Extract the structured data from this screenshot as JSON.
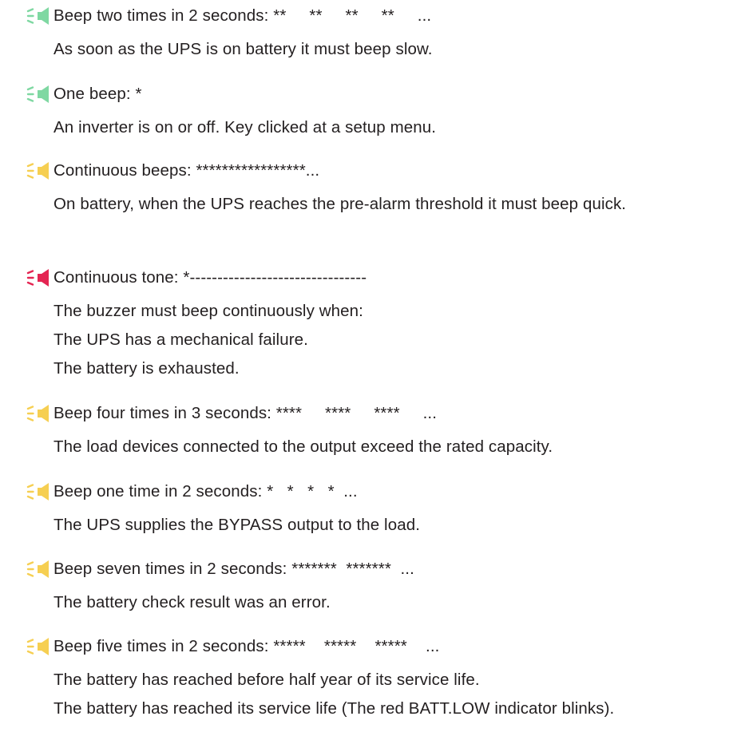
{
  "colors": {
    "green": "#7fd8a2",
    "yellow": "#f6cf52",
    "red": "#e42552",
    "text": "#231f20"
  },
  "icon_name": "speaker-beep-icon",
  "entries": [
    {
      "color": "green",
      "title": "Beep two times in 2 seconds: **     **     **     **     ...",
      "lines": [
        "As soon as the UPS is on battery it must beep slow."
      ]
    },
    {
      "color": "green",
      "title": "One beep: *",
      "lines": [
        "An inverter is on or off. Key clicked at a setup menu."
      ]
    },
    {
      "color": "yellow",
      "title": "Continuous beeps: *****************...",
      "lines": [
        "On battery, when the UPS reaches the pre-alarm threshold it must beep quick."
      ]
    },
    {
      "color": "red",
      "title": "Continuous tone: *--------------------------------",
      "lines": [
        "The buzzer must beep continuously when:",
        "The UPS has a mechanical failure.",
        "The battery is exhausted."
      ]
    },
    {
      "color": "yellow",
      "title": "Beep four times in 3 seconds: ****     ****     ****     ...",
      "lines": [
        "The load devices connected to the output exceed the rated capacity."
      ]
    },
    {
      "color": "yellow",
      "title": "Beep one time in 2 seconds: *   *   *   *  ...",
      "lines": [
        "The UPS supplies the BYPASS output to the load."
      ]
    },
    {
      "color": "yellow",
      "title": "Beep seven times in 2 seconds: *******  *******  ...",
      "lines": [
        "The battery check result was an error."
      ]
    },
    {
      "color": "yellow",
      "title": "Beep five times in 2 seconds: *****    *****    *****    ...",
      "lines": [
        "The battery has reached before half year of its service life.",
        "The battery has reached its service life (The red BATT.LOW indicator blinks)."
      ]
    }
  ]
}
